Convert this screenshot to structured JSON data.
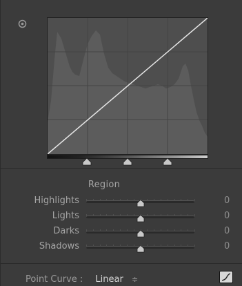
{
  "tone_curve": {
    "target_icon": "targeted-adjustment-icon",
    "split_points_count": 3
  },
  "region": {
    "title": "Region",
    "sliders": [
      {
        "label": "Highlights",
        "value": "0",
        "position": 0.5
      },
      {
        "label": "Lights",
        "value": "0",
        "position": 0.5
      },
      {
        "label": "Darks",
        "value": "0",
        "position": 0.5
      },
      {
        "label": "Shadows",
        "value": "0",
        "position": 0.5
      }
    ]
  },
  "point_curve": {
    "label": "Point Curve :",
    "value": "Linear",
    "arrows": "≑"
  },
  "colors": {
    "panel_bg": "#3b3b3b",
    "graph_bg": "#4e4e4e",
    "histogram": "#5c5c5c",
    "curve_line": "#e6e6e6"
  }
}
